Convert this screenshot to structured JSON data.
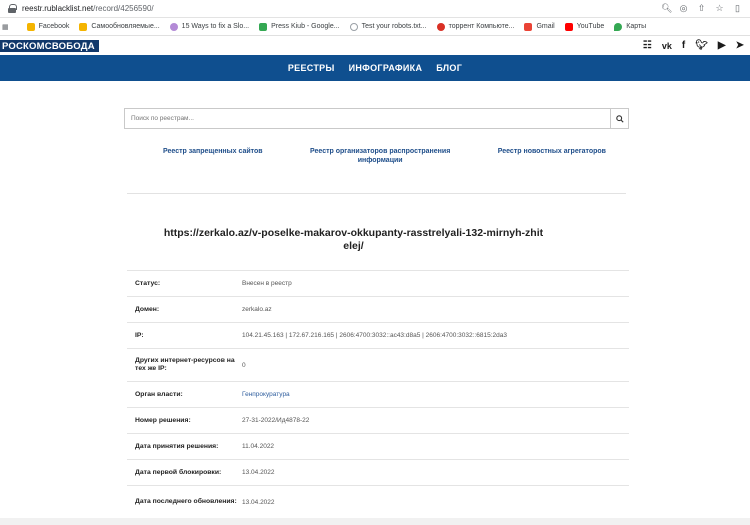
{
  "browser": {
    "url_host": "reestr.rublacklist.net",
    "url_path": "/record/4256590/",
    "bookmarks": [
      {
        "label": "Facebook",
        "color": "#f4b400"
      },
      {
        "label": "Самообновляемые...",
        "color": "#f4b400"
      },
      {
        "label": "15 Ways to fix a Slo...",
        "color": "#b38ad6"
      },
      {
        "label": "Press Kiub - Google...",
        "color": "#34a853"
      },
      {
        "label": "Test your robots.txt...",
        "color": "#9aa0a6"
      },
      {
        "label": "торрент Компьюте...",
        "color": "#d93025"
      },
      {
        "label": "Gmail",
        "color": "#ea4335"
      },
      {
        "label": "YouTube",
        "color": "#ff0000"
      },
      {
        "label": "Карты",
        "color": "#34a853"
      }
    ]
  },
  "site": {
    "logo": "РОСКОМСВОБОДА",
    "nav": [
      "РЕЕСТРЫ",
      "ИНФОГРАФИКА",
      "БЛОГ"
    ]
  },
  "search": {
    "placeholder": "Поиск по реестрам..."
  },
  "links": {
    "banned": "Реестр запрещенных сайтов",
    "organizers": "Реестр организаторов распространения информации",
    "aggregators": "Реестр новостных агрегаторов"
  },
  "record": {
    "title": "https://zerkalo.az/v-poselke-makarov-okkupanty-rasstrelyali-132-mirnyh-zhitelej/",
    "rows": [
      {
        "key": "Статус:",
        "value": "Внесен в реестр"
      },
      {
        "key": "Домен:",
        "value": "zerkalo.az"
      },
      {
        "key": "IP:",
        "value": "104.21.45.163 | 172.67.216.165 | 2606:4700:3032::ac43:d8a5 | 2606:4700:3032::6815:2da3"
      },
      {
        "key": "Других интернет-ресурсов на тех же IP:",
        "value": "0"
      },
      {
        "key": "Орган власти:",
        "value": "Генпрокуратура"
      },
      {
        "key": "Номер решения:",
        "value": "27-31-2022/Ид4878-22"
      },
      {
        "key": "Дата принятия решения:",
        "value": "11.04.2022"
      },
      {
        "key": "Дата первой блокировки:",
        "value": "13.04.2022"
      },
      {
        "key": "Дата последнего обновления:",
        "value": "13.04.2022"
      }
    ]
  }
}
